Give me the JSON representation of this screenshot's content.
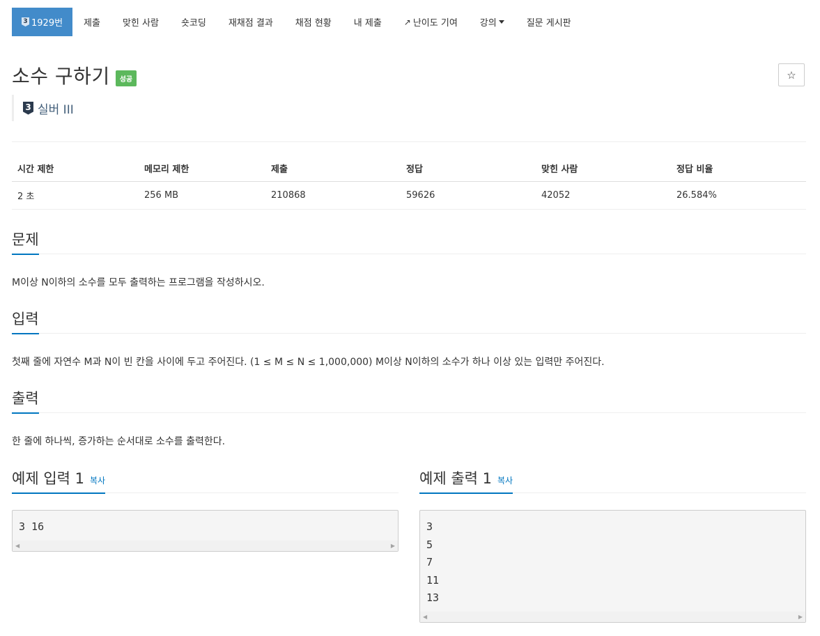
{
  "nav": {
    "items": [
      {
        "label": "1929번",
        "badge": "3"
      },
      {
        "label": "제출"
      },
      {
        "label": "맞힌 사람"
      },
      {
        "label": "숏코딩"
      },
      {
        "label": "재채점 결과"
      },
      {
        "label": "채점 현황"
      },
      {
        "label": "내 제출"
      },
      {
        "label": "난이도 기여",
        "icon": "external-link-icon"
      },
      {
        "label": "강의",
        "icon": "caret-down-icon"
      },
      {
        "label": "질문 게시판"
      }
    ]
  },
  "problem": {
    "title": "소수 구하기",
    "status": "성공",
    "tier_badge": "3",
    "tier": "실버 III",
    "star": "☆"
  },
  "info_table": {
    "headers": [
      "시간 제한",
      "메모리 제한",
      "제출",
      "정답",
      "맞힌 사람",
      "정답 비율"
    ],
    "values": [
      "2 초",
      "256 MB",
      "210868",
      "59626",
      "42052",
      "26.584%"
    ]
  },
  "sections": {
    "description": {
      "title": "문제",
      "body": "M이상 N이하의 소수를 모두 출력하는 프로그램을 작성하시오."
    },
    "input": {
      "title": "입력",
      "body": "첫째 줄에 자연수 M과 N이 빈 칸을 사이에 두고 주어진다. (1 ≤ M ≤ N ≤ 1,000,000) M이상 N이하의 소수가 하나 이상 있는 입력만 주어진다."
    },
    "output": {
      "title": "출력",
      "body": "한 줄에 하나씩, 증가하는 순서대로 소수를 출력한다."
    }
  },
  "samples": {
    "input": {
      "title": "예제 입력 1",
      "copy": "복사",
      "content": "3 16"
    },
    "output": {
      "title": "예제 출력 1",
      "copy": "복사",
      "content": "3\n5\n7\n11\n13"
    }
  },
  "colors": {
    "accent": "#428bca",
    "link": "#0076c0",
    "success": "#5cb85c",
    "tier": "#435f7a"
  }
}
